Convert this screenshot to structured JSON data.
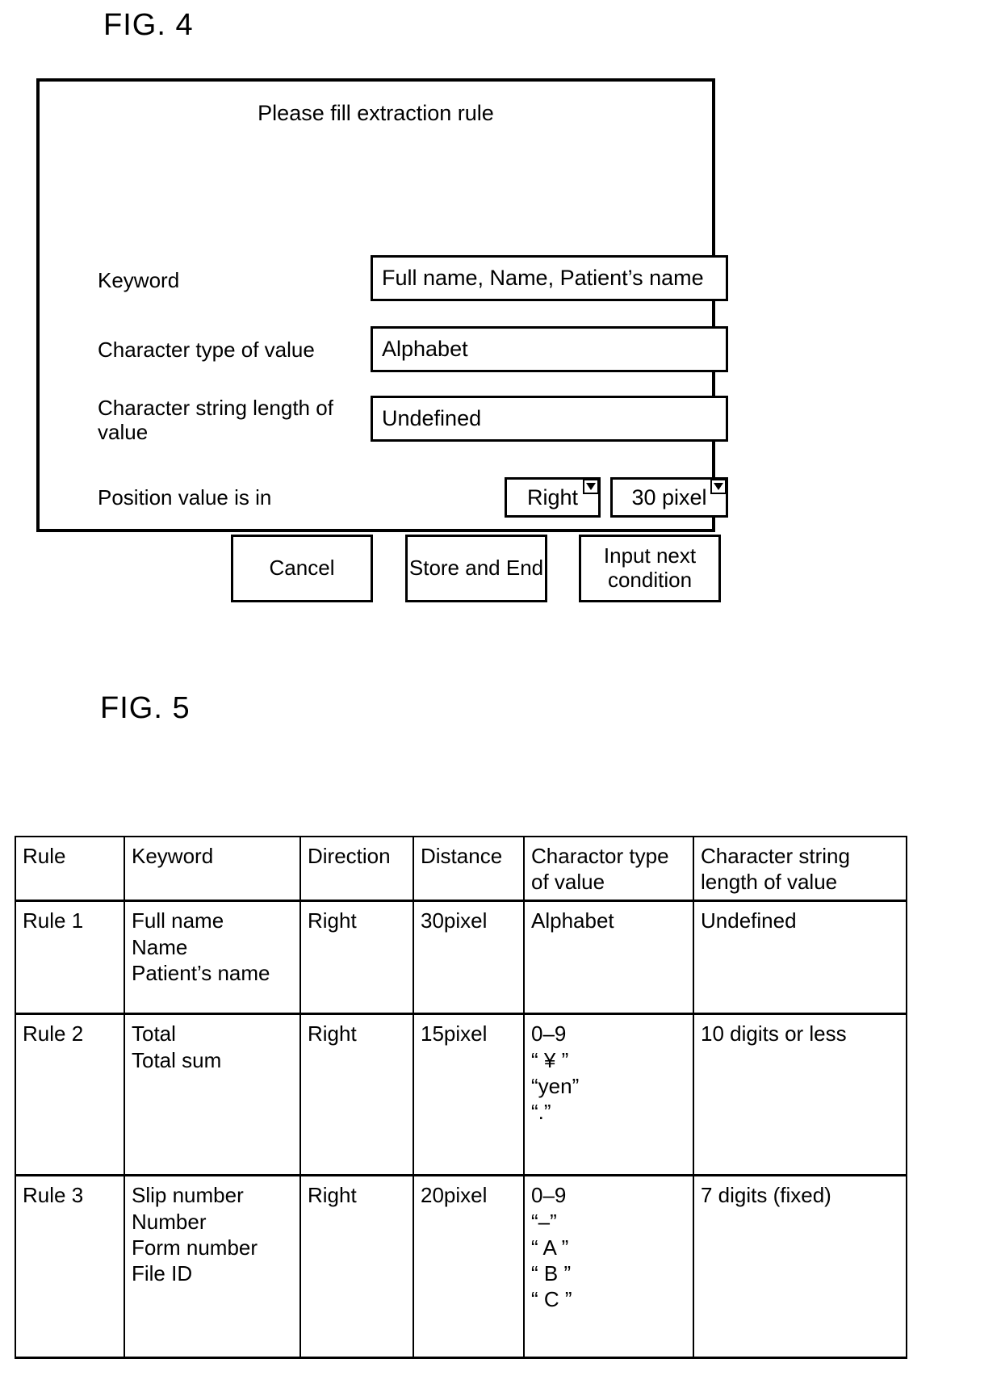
{
  "figures": {
    "fig4_label": "FIG. 4",
    "fig5_label": "FIG. 5"
  },
  "dialog": {
    "title": "Please fill extraction rule",
    "fields": [
      {
        "label": "Keyword",
        "value": "Full name, Name, Patient’s name"
      },
      {
        "label": "Character type of value",
        "value": "Alphabet"
      },
      {
        "label": "Character string length of value",
        "value": "Undefined"
      }
    ],
    "position_row": {
      "label": "Position value is in",
      "direction": {
        "value": "Right",
        "icon": "chevron-down-icon"
      },
      "distance": {
        "value": "30 pixel",
        "icon": "chevron-down-icon"
      }
    },
    "buttons": [
      {
        "label": "Cancel"
      },
      {
        "label": "Store and End"
      },
      {
        "label": "Input next condition",
        "line1": "Input next",
        "line2": "condition"
      }
    ]
  },
  "table": {
    "headers": {
      "rule": "Rule",
      "keyword": "Keyword",
      "direction": "Direction",
      "distance": "Distance",
      "chartype_line1": "Charactor type",
      "chartype_line2": "of value",
      "charlen_line1": "Character string",
      "charlen_line2": "length of value"
    },
    "rows": [
      {
        "rule": "Rule 1",
        "keywords": [
          "Full name",
          "Name",
          "Patient’s name"
        ],
        "direction": "Right",
        "distance": "30pixel",
        "chartype": [
          "Alphabet"
        ],
        "charlen": "Undefined"
      },
      {
        "rule": "Rule 2",
        "keywords": [
          "Total",
          "Total sum"
        ],
        "direction": "Right",
        "distance": "15pixel",
        "chartype": [
          "0–9",
          "“ ¥ ”",
          "“yen”",
          "“.”"
        ],
        "charlen": "10 digits or less"
      },
      {
        "rule": "Rule 3",
        "keywords": [
          "Slip number",
          "Number",
          "Form number",
          "File ID"
        ],
        "direction": "Right",
        "distance": "20pixel",
        "chartype": [
          "0–9",
          "“–”",
          "“ A ”",
          "“ B ”",
          "“ C ”"
        ],
        "charlen": "7 digits (fixed)"
      }
    ]
  },
  "colors": {
    "ink": "#000000",
    "paper": "#ffffff"
  }
}
